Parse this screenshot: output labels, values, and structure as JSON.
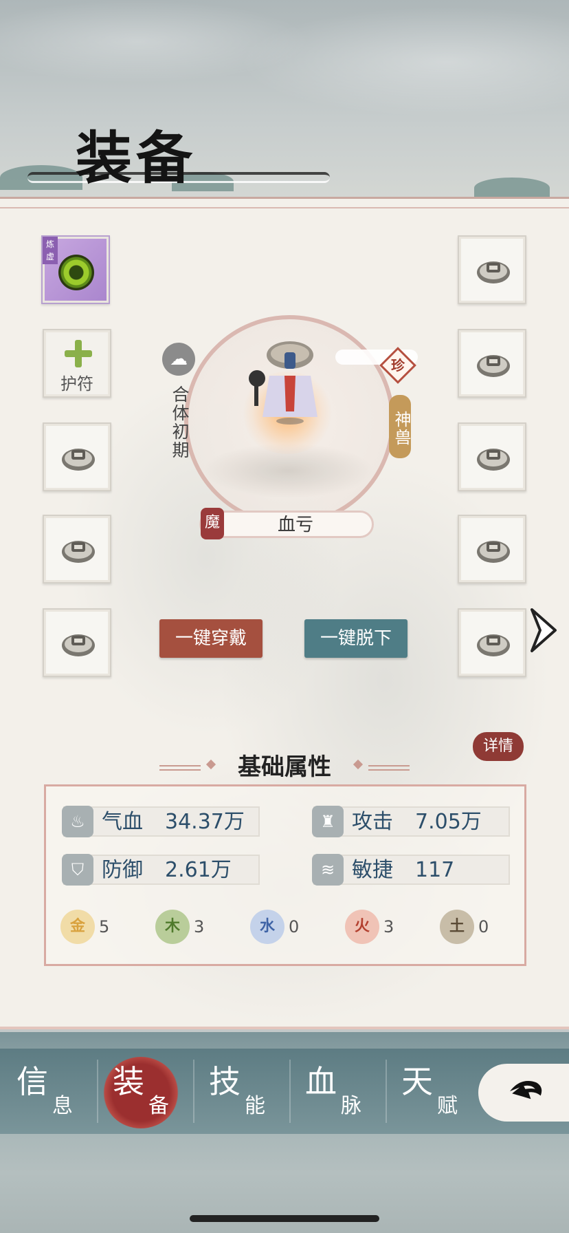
{
  "header": {
    "title": "装备"
  },
  "left_slots": [
    {
      "type": "gem",
      "tag": "炼虚"
    },
    {
      "type": "amulet",
      "label": "护符"
    },
    {
      "type": "locked"
    },
    {
      "type": "locked"
    },
    {
      "type": "locked"
    }
  ],
  "right_slots": [
    {
      "type": "locked"
    },
    {
      "type": "locked"
    },
    {
      "type": "locked"
    },
    {
      "type": "locked"
    },
    {
      "type": "locked"
    }
  ],
  "pet": {
    "realm": "合体初期",
    "rarity": "珍",
    "category": "神兽",
    "seal": "魔",
    "name": "血亏"
  },
  "buttons": {
    "wear_all": "一键穿戴",
    "remove_all": "一键脱下"
  },
  "stats": {
    "title": "基础属性",
    "detail": "详情",
    "items": [
      {
        "label": "气血",
        "value": "34.37万",
        "icon": "droplet-icon"
      },
      {
        "label": "攻击",
        "value": "7.05万",
        "icon": "fist-icon"
      },
      {
        "label": "防御",
        "value": "2.61万",
        "icon": "shield-icon"
      },
      {
        "label": "敏捷",
        "value": "117",
        "icon": "wing-icon"
      }
    ],
    "elements": [
      {
        "name": "金",
        "value": "5",
        "color": "#d9a23e",
        "bg": "#f1dca7"
      },
      {
        "name": "木",
        "value": "3",
        "color": "#4f7a2c",
        "bg": "#b9cd9a"
      },
      {
        "name": "水",
        "value": "0",
        "color": "#3e63a6",
        "bg": "#c4d2ea"
      },
      {
        "name": "火",
        "value": "3",
        "color": "#b3402f",
        "bg": "#f0c3b6"
      },
      {
        "name": "土",
        "value": "0",
        "color": "#5b4b36",
        "bg": "#c8bda8"
      }
    ]
  },
  "nav": [
    {
      "big": "信",
      "small": "息"
    },
    {
      "big": "装",
      "small": "备",
      "active": true
    },
    {
      "big": "技",
      "small": "能"
    },
    {
      "big": "血",
      "small": "脉"
    },
    {
      "big": "天",
      "small": "赋"
    }
  ],
  "colors": {
    "accent_red": "#9b2f2f",
    "accent_teal": "#4f7d86",
    "panel_border": "#d8aaa2"
  }
}
